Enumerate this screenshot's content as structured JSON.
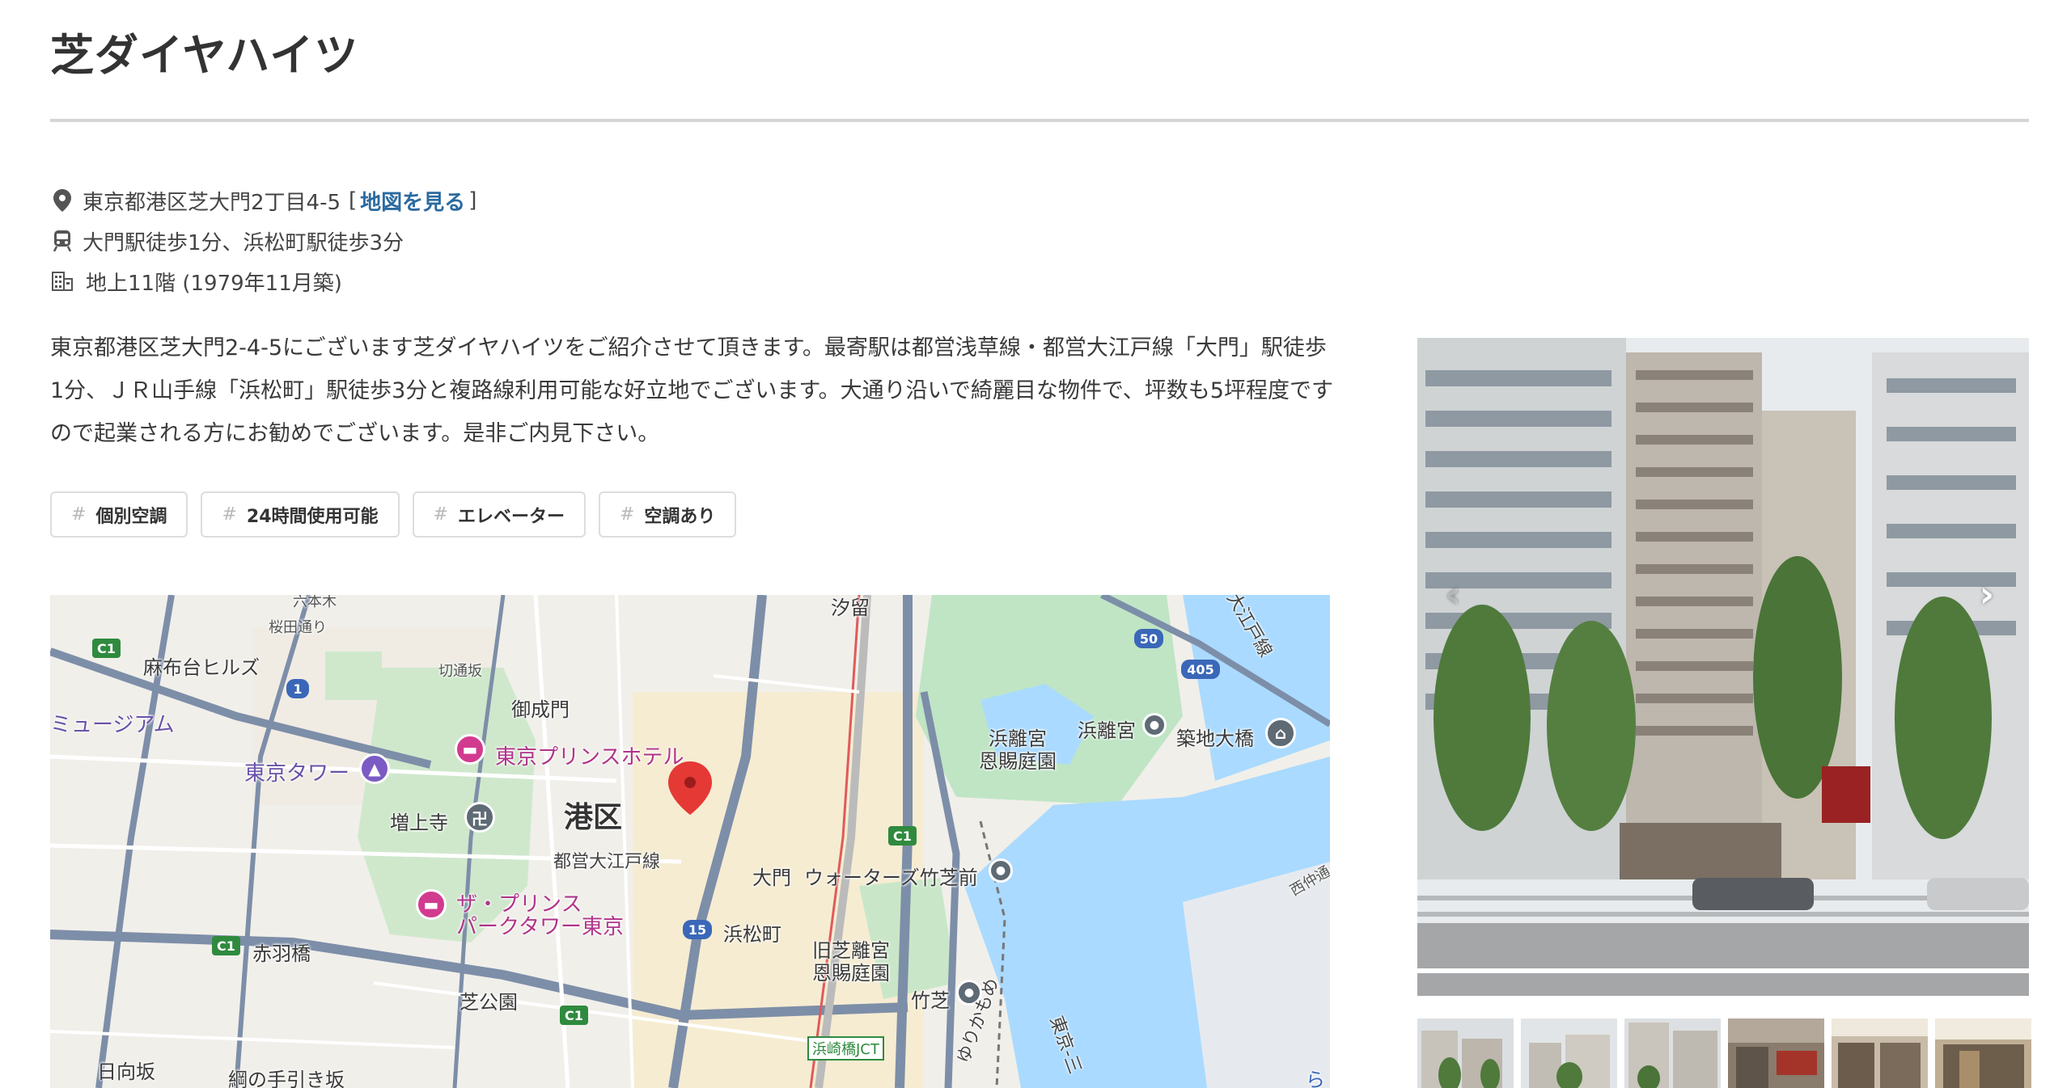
{
  "property": {
    "name": "芝ダイヤハイツ",
    "address": "東京都港区芝大門2丁目4-5",
    "map_link_label": "地図を見る",
    "bracket_open": "[",
    "bracket_close": "]",
    "access": "大門駅徒歩1分、浜松町駅徒歩3分",
    "building": "地上11階 (1979年11月築)",
    "description_lines": [
      "東京都港区芝大門2-4-5にございます芝ダイヤハイツをご紹介させて頂きます。最寄駅は都営浅草線・都営大江戸線「大門」駅徒歩",
      "1分、ＪＲ山手線「浜松町」駅徒歩3分と複路線利用可能な好立地でございます。大通り沿いで綺麗目な物件で、坪数も5坪程度です",
      "ので起業される方にお勧めでございます。是非ご内見下さい。"
    ],
    "tags": [
      {
        "hash": "#",
        "label": "個別空調"
      },
      {
        "hash": "#",
        "label": "24時間使用可能"
      },
      {
        "hash": "#",
        "label": "エレベーター"
      },
      {
        "hash": "#",
        "label": "空調あり"
      }
    ]
  },
  "icons": {
    "address": "map-pin-icon",
    "access": "train-icon",
    "building": "building-icon"
  },
  "map": {
    "labels": {
      "azabudai": "麻布台ヒルズ",
      "museum": "ミュージアム",
      "tokyo_tower": "東京タワー",
      "tokyo_prince": "東京プリンスホテル",
      "zojoji": "増上寺",
      "onarimon": "御成門",
      "minato": "港区",
      "oedo_line": "都営大江戸線",
      "daimon": "大門",
      "waters": "ウォーターズ竹芝前",
      "prince_park_1": "ザ・プリンス",
      "prince_park_2": "パークタワー東京",
      "hamamatsucho": "浜松町",
      "kyu_shiba_1": "旧芝離宮",
      "kyu_shiba_2": "恩賜庭園",
      "akabanebashi": "赤羽橋",
      "shibakoen": "芝公園",
      "hinatazaka": "日向坂",
      "tsuna": "綱の手引き坂",
      "hamarikyu_1": "浜離宮",
      "hamarikyu_2": "恩賜庭園",
      "hamarikyu_station": "浜離宮",
      "tsukiji_ohashi": "築地大橋",
      "shiodome": "汐留",
      "takeshiba": "竹芝",
      "hamazakibashi": "浜崎橋JCT",
      "sakurada": "桜田通り",
      "kiridoshi": "切通坂",
      "oedo_top": "大江戸線",
      "yurikamome": "ゆりかもめ",
      "tokyo_sanshi": "東京-三",
      "shibaura": "西仲通",
      "roppongi": "六本木",
      "ra": "ら"
    },
    "shields": {
      "c1_a": "C1",
      "c1_b": "C1",
      "c1_c": "C1",
      "c1_d": "C1",
      "r1": "1",
      "r15": "15",
      "r50": "50",
      "r405": "405"
    }
  },
  "gallery": {
    "prev_icon": "‹",
    "next_icon": "›",
    "thumb_count": 6
  }
}
